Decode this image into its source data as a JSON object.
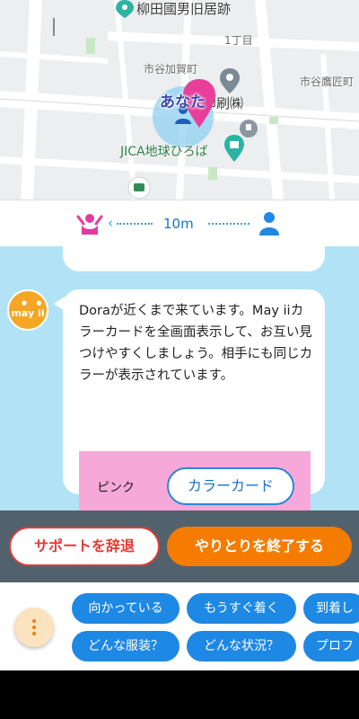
{
  "map": {
    "labels": {
      "shrine": "柳田國男旧居跡",
      "block": "1丁目",
      "district": "市谷加賀町",
      "district2": "市谷鷹匠町",
      "printing": "印刷㈱",
      "plaza": "JICA地球ひろば"
    },
    "you_label": "あなた",
    "colors": {
      "pin": "#e8409a",
      "location_circle": "#8fd0f2"
    }
  },
  "distance": {
    "value": "10m",
    "arrow": "‹"
  },
  "chat": {
    "avatar_logo": "may ii",
    "message": "Doraが近くまで来ています。May iiカラーカードを全画面表示して、お互い見つけやすくしましょう。相手にも同じカラーが表示されています。",
    "color_card": {
      "color_name": "ピンク",
      "button_label": "カラーカード",
      "color": "#f6a9d9"
    }
  },
  "actions": {
    "decline_label": "サポートを辞退",
    "end_label": "やりとりを終了する"
  },
  "quick_replies": {
    "row1": [
      "向かっている",
      "もうすぐ着く",
      "到着し"
    ],
    "row2": [
      "どんな服装？",
      "どんな状況？",
      "プロフ"
    ]
  },
  "icons": [
    "pin-icon",
    "person-icon",
    "location-marker-icon",
    "gift-icon",
    "train-icon",
    "raised-hands-person-icon",
    "user-icon",
    "more-vertical-icon"
  ]
}
